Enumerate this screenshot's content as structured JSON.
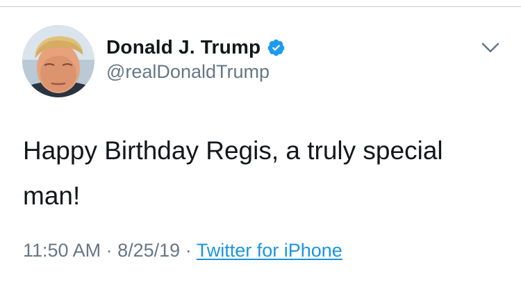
{
  "author": {
    "display_name": "Donald J. Trump",
    "handle": "@realDonaldTrump",
    "verified": true,
    "verified_color": "#1d9bf0",
    "avatar_icon": "profile-photo"
  },
  "tweet": {
    "text": "Happy Birthday Regis, a truly special man!"
  },
  "meta": {
    "time": "11:50 AM",
    "separator": "·",
    "date": "8/25/19",
    "source": "Twitter for iPhone"
  },
  "menu": {
    "icon": "chevron-down-icon"
  },
  "colors": {
    "text_primary": "#14171a",
    "text_secondary": "#657786",
    "link": "#1b95e0"
  }
}
